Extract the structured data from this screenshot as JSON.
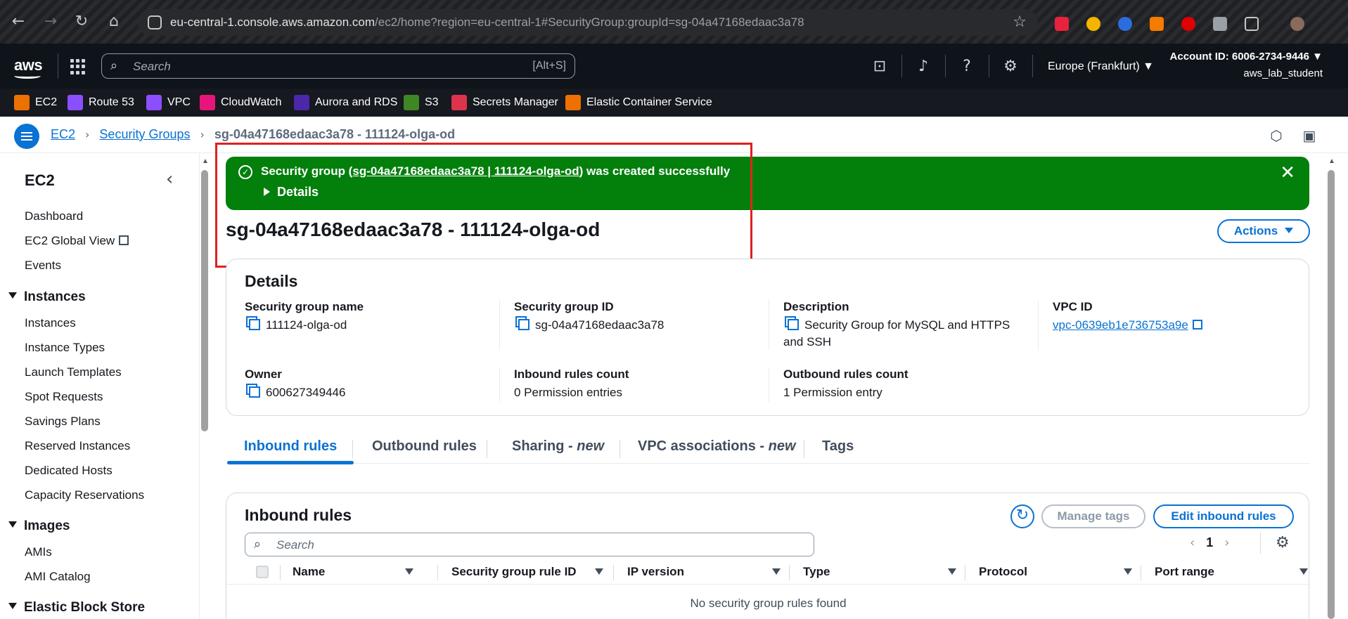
{
  "browser": {
    "url_host": "eu-central-1.console.aws.amazon.com",
    "url_path": "/ec2/home?region=eu-central-1#SecurityGroup:groupId=sg-04a47168edaac3a78"
  },
  "header": {
    "logo": "aws",
    "search_placeholder": "Search",
    "search_shortcut": "[Alt+S]",
    "region": "Europe (Frankfurt) ▼",
    "account_id": "Account ID: 6006-2734-9446 ▼",
    "username": "aws_lab_student"
  },
  "favorites": [
    {
      "label": "EC2",
      "color": "#ed7100"
    },
    {
      "label": "Route 53",
      "color": "#8c4fff"
    },
    {
      "label": "VPC",
      "color": "#8c4fff"
    },
    {
      "label": "CloudWatch",
      "color": "#e7157b"
    },
    {
      "label": "Aurora and RDS",
      "color": "#4d27aa"
    },
    {
      "label": "S3",
      "color": "#3f8624"
    },
    {
      "label": "Secrets Manager",
      "color": "#dd344c"
    },
    {
      "label": "Elastic Container Service",
      "color": "#ed7100"
    }
  ],
  "breadcrumb": {
    "items": [
      "EC2",
      "Security Groups"
    ],
    "current": "sg-04a47168edaac3a78 - 111124-olga-od"
  },
  "sidebar": {
    "title": "EC2",
    "top_items": [
      "Dashboard",
      "EC2 Global View",
      "Events"
    ],
    "instances_header": "Instances",
    "instances_items": [
      "Instances",
      "Instance Types",
      "Launch Templates",
      "Spot Requests",
      "Savings Plans",
      "Reserved Instances",
      "Dedicated Hosts",
      "Capacity Reservations"
    ],
    "images_header": "Images",
    "images_items": [
      "AMIs",
      "AMI Catalog"
    ],
    "ebs_header": "Elastic Block Store"
  },
  "flash": {
    "prefix": "Security group (",
    "link": "sg-04a47168edaac3a78 | 111124-olga-od",
    "suffix": ") was created successfully",
    "details": "Details"
  },
  "page": {
    "title": "sg-04a47168edaac3a78 - 111124-olga-od",
    "actions": "Actions"
  },
  "details": {
    "heading": "Details",
    "sg_name_label": "Security group name",
    "sg_name": "111124-olga-od",
    "sg_id_label": "Security group ID",
    "sg_id": "sg-04a47168edaac3a78",
    "desc_label": "Description",
    "desc": "Security Group for MySQL and HTTPS and SSH",
    "vpc_label": "VPC ID",
    "vpc": "vpc-0639eb1e736753a9e",
    "owner_label": "Owner",
    "owner": "600627349446",
    "inbound_label": "Inbound rules count",
    "inbound": "0 Permission entries",
    "outbound_label": "Outbound rules count",
    "outbound": "1 Permission entry"
  },
  "tabs": [
    {
      "label": "Inbound rules",
      "suffix": ""
    },
    {
      "label": "Outbound rules",
      "suffix": ""
    },
    {
      "label": "Sharing - ",
      "suffix": "new"
    },
    {
      "label": "VPC associations - ",
      "suffix": "new"
    },
    {
      "label": "Tags",
      "suffix": ""
    }
  ],
  "rules": {
    "heading": "Inbound rules",
    "manage_tags": "Manage tags",
    "edit": "Edit inbound rules",
    "search_placeholder": "Search",
    "page": "1",
    "columns": [
      "Name",
      "Security group rule ID",
      "IP version",
      "Type",
      "Protocol",
      "Port range"
    ],
    "empty": "No security group rules found"
  }
}
